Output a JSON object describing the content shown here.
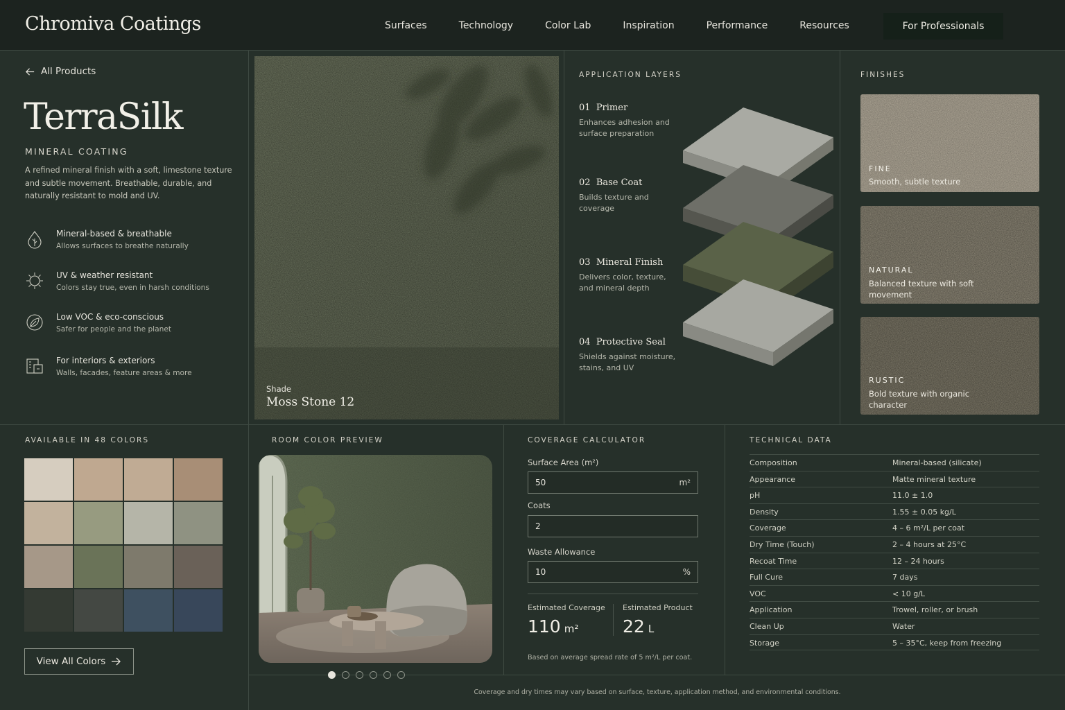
{
  "brand": "Chromiva Coatings",
  "nav": {
    "items": [
      "Surfaces",
      "Technology",
      "Color Lab",
      "Inspiration",
      "Performance",
      "Resources"
    ],
    "cta": "For Professionals"
  },
  "product": {
    "back_link": "All Products",
    "name": "TerraSilk",
    "category": "MINERAL COATING",
    "description": "A refined mineral finish with a soft, limestone texture and subtle movement. Breathable, durable, and naturally resistant to mold and UV.",
    "features": [
      {
        "title": "Mineral-based & breathable",
        "desc": "Allows surfaces to breathe naturally",
        "icon": "leaf-drop-icon"
      },
      {
        "title": "UV & weather resistant",
        "desc": "Colors stay true, even in harsh conditions",
        "icon": "sun-shield-icon"
      },
      {
        "title": "Low VOC & eco-conscious",
        "desc": "Safer for people and the planet",
        "icon": "eco-leaf-icon"
      },
      {
        "title": "For interiors & exteriors",
        "desc": "Walls, facades, feature areas & more",
        "icon": "building-icon"
      }
    ]
  },
  "hero": {
    "shade_label": "Shade",
    "shade_name": "Moss Stone 12"
  },
  "layers": {
    "title": "APPLICATION LAYERS",
    "items": [
      {
        "num": "01",
        "name": "Primer",
        "desc": "Enhances adhesion and surface preparation"
      },
      {
        "num": "02",
        "name": "Base Coat",
        "desc": "Builds texture and coverage"
      },
      {
        "num": "03",
        "name": "Mineral Finish",
        "desc": "Delivers color, texture, and mineral depth"
      },
      {
        "num": "04",
        "name": "Protective Seal",
        "desc": "Shields against moisture, stains, and UV"
      }
    ]
  },
  "finishes": {
    "title": "FINISHES",
    "items": [
      {
        "name": "FINE",
        "desc": "Smooth, subtle texture",
        "color": "#a49c8c"
      },
      {
        "name": "NATURAL",
        "desc": "Balanced texture with soft movement",
        "color": "#7e7868"
      },
      {
        "name": "RUSTIC",
        "desc": "Bold texture with organic character",
        "color": "#6b6656"
      }
    ]
  },
  "colors": {
    "title": "AVAILABLE IN 48 COLORS",
    "swatches": [
      "#d6cdbf",
      "#bfa890",
      "#c0ab94",
      "#a88e76",
      "#c2b29d",
      "#979b80",
      "#b5b5a8",
      "#8f9282",
      "#a69888",
      "#6a7358",
      "#7e7a6c",
      "#6a6158",
      "#343a33",
      "#444843",
      "#3e5060",
      "#38475a"
    ],
    "view_all": "View All Colors"
  },
  "room_preview": {
    "title": "ROOM COLOR PREVIEW",
    "slides": 6,
    "active_slide": 1
  },
  "calculator": {
    "title": "COVERAGE CALCULATOR",
    "surface_area_label": "Surface Area (m²)",
    "surface_area_value": "50",
    "surface_area_unit": "m²",
    "coats_label": "Coats",
    "coats_value": "2",
    "waste_label": "Waste Allowance",
    "waste_value": "10",
    "waste_unit": "%",
    "est_coverage_label": "Estimated Coverage",
    "est_coverage_value": "110",
    "est_coverage_unit": "m²",
    "est_product_label": "Estimated Product",
    "est_product_value": "22",
    "est_product_unit": "L",
    "note": "Based on average spread rate of 5 m²/L per coat."
  },
  "technical": {
    "title": "TECHNICAL DATA",
    "rows": [
      [
        "Composition",
        "Mineral-based (silicate)"
      ],
      [
        "Appearance",
        "Matte mineral texture"
      ],
      [
        "pH",
        "11.0 ± 1.0"
      ],
      [
        "Density",
        "1.55 ± 0.05 kg/L"
      ],
      [
        "Coverage",
        "4 – 6 m²/L per coat"
      ],
      [
        "Dry Time (Touch)",
        "2 – 4 hours at 25°C"
      ],
      [
        "Recoat Time",
        "12 – 24 hours"
      ],
      [
        "Full Cure",
        "7 days"
      ],
      [
        "VOC",
        "< 10 g/L"
      ],
      [
        "Application",
        "Trowel, roller, or brush"
      ],
      [
        "Clean Up",
        "Water"
      ],
      [
        "Storage",
        "5 – 35°C, keep from freezing"
      ]
    ]
  },
  "disclaimer": "Coverage and dry times may vary based on surface, texture, application method, and environmental conditions."
}
